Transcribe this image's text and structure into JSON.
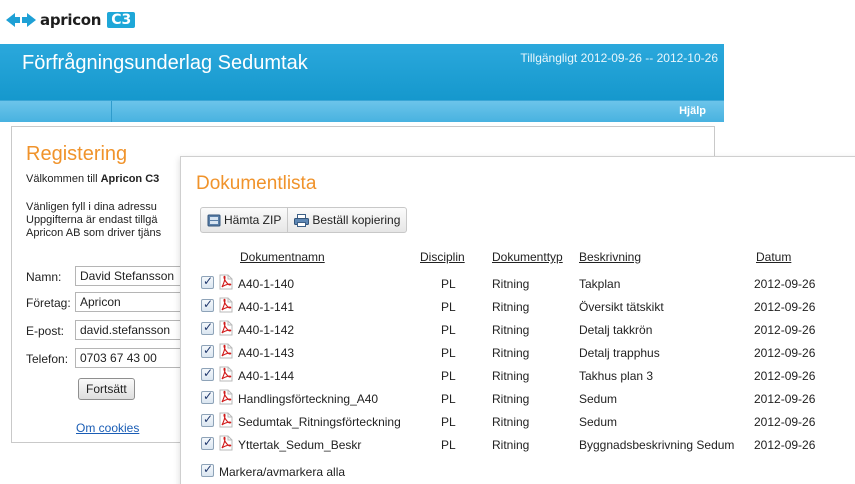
{
  "brand": {
    "name": "apricon",
    "product": "C3",
    "logo_icon": "apricon-arrows-logo"
  },
  "header": {
    "title": "Förfrågningsunderlag Sedumtak",
    "availability": "Tillgängligt 2012-09-26 -- 2012-10-26",
    "help_label": "Hjälp"
  },
  "registration": {
    "title": "Registering",
    "welcome_prefix": "Välkommen till ",
    "welcome_bold": "Apricon C3",
    "lines": [
      "Vänligen fyll i dina adressu",
      "Uppgifterna är endast tillgä",
      "Apricon AB som driver tjäns"
    ],
    "fields": {
      "name_label": "Namn:",
      "name_value": "David Stefansson",
      "company_label": "Företag:",
      "company_value": "Apricon",
      "email_label": "E-post:",
      "email_value": "david.stefansson",
      "phone_label": "Telefon:",
      "phone_value": "0703 67 43 00"
    },
    "continue_button": "Fortsätt",
    "cookies_link": "Om cookies"
  },
  "doclist": {
    "title": "Dokumentlista",
    "toolbar": {
      "zip_button": "Hämta ZIP",
      "copy_button": "Beställ kopiering"
    },
    "columns": {
      "name": "Dokumentnamn",
      "discipline": "Disciplin",
      "type": "Dokumenttyp",
      "description": "Beskrivning",
      "date": "Datum"
    },
    "rows": [
      {
        "name": "A40-1-140",
        "discipline": "PL",
        "type": "Ritning",
        "description": "Takplan",
        "date": "2012-09-26"
      },
      {
        "name": "A40-1-141",
        "discipline": "PL",
        "type": "Ritning",
        "description": "Översikt tätskikt",
        "date": "2012-09-26"
      },
      {
        "name": "A40-1-142",
        "discipline": "PL",
        "type": "Ritning",
        "description": "Detalj takkrön",
        "date": "2012-09-26"
      },
      {
        "name": "A40-1-143",
        "discipline": "PL",
        "type": "Ritning",
        "description": "Detalj trapphus",
        "date": "2012-09-26"
      },
      {
        "name": "A40-1-144",
        "discipline": "PL",
        "type": "Ritning",
        "description": "Takhus plan 3",
        "date": "2012-09-26"
      },
      {
        "name": "Handlingsförteckning_A40",
        "discipline": "PL",
        "type": "Ritning",
        "description": "Sedum",
        "date": "2012-09-26"
      },
      {
        "name": "Sedumtak_Ritningsförteckning",
        "discipline": "PL",
        "type": "Ritning",
        "description": "Sedum",
        "date": "2012-09-26"
      },
      {
        "name": "Yttertak_Sedum_Beskr",
        "discipline": "PL",
        "type": "Ritning",
        "description": "Byggnadsbeskrivning Sedum",
        "date": "2012-09-26"
      }
    ],
    "toggle_all_label": "Markera/avmarkera alla"
  },
  "colors": {
    "accent_orange": "#f0932b",
    "header_blue": "#1ea0d5",
    "link_blue": "#1a5db5"
  }
}
